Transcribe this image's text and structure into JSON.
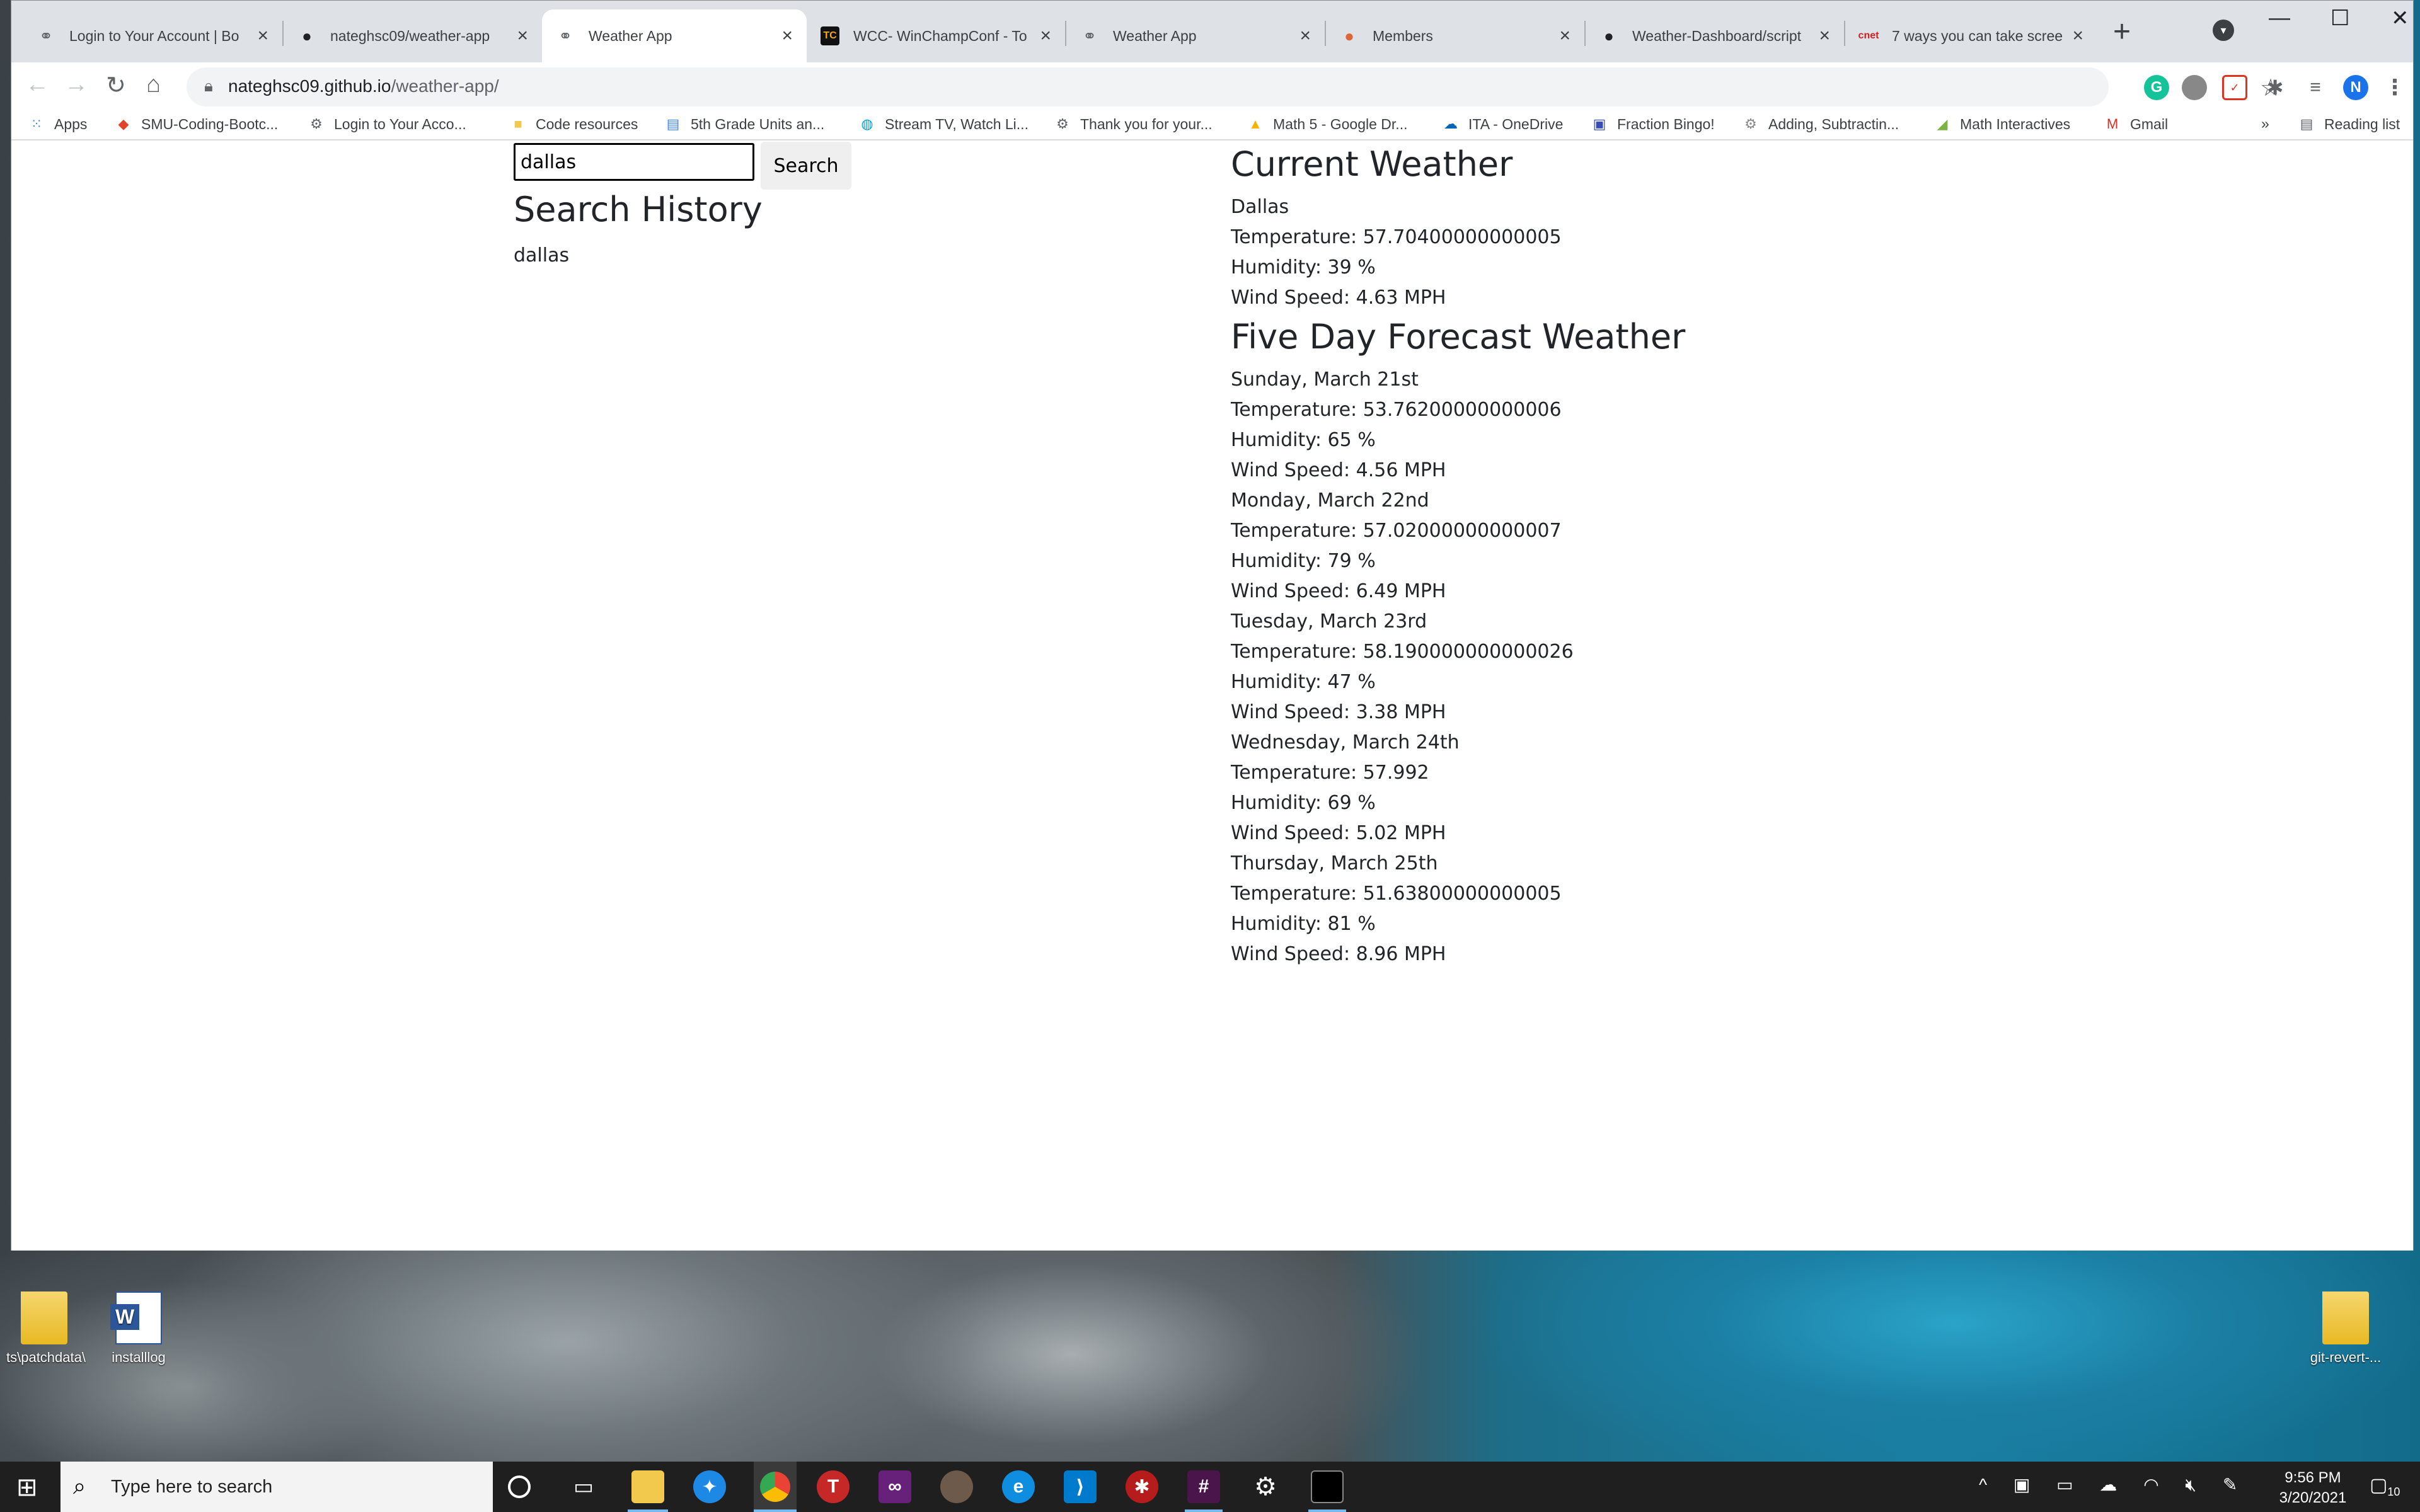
{
  "tabs": [
    {
      "title": "Login to Your Account | Bo",
      "icon": "globe-icon"
    },
    {
      "title": "nateghsc09/weather-app",
      "icon": "github-icon"
    },
    {
      "title": "Weather App",
      "icon": "globe-icon",
      "active": true
    },
    {
      "title": "WCC- WinChampConf - To",
      "icon": "tc-icon"
    },
    {
      "title": "Weather App",
      "icon": "globe-icon"
    },
    {
      "title": "Members",
      "icon": "members-icon"
    },
    {
      "title": "Weather-Dashboard/script",
      "icon": "github-icon"
    },
    {
      "title": "7 ways you can take scree",
      "icon": "cnet-icon"
    }
  ],
  "address": {
    "host": "nateghsc09.github.io",
    "path": "/weather-app/"
  },
  "profile_initial": "N",
  "bookmarks": [
    "Apps",
    "SMU-Coding-Bootc...",
    "Login to Your Acco...",
    "Code resources",
    "5th Grade Units an...",
    "Stream TV, Watch Li...",
    "Thank you for your...",
    "Math 5 - Google Dr...",
    "ITA - OneDrive",
    "Fraction Bingo!",
    "Adding, Subtractin...",
    "Math Interactives",
    "Gmail"
  ],
  "bookmarks_more": "»",
  "reading_list": "Reading list",
  "app": {
    "search_value": "dallas",
    "search_button": "Search",
    "history_title": "Search History",
    "history": [
      "dallas"
    ],
    "current_title": "Current Weather",
    "current": {
      "city": "Dallas",
      "temperature": "Temperature: 57.70400000000005",
      "humidity": "Humidity: 39 %",
      "wind": "Wind Speed: 4.63 MPH"
    },
    "forecast_title": "Five Day Forecast Weather",
    "forecast": [
      {
        "date": "Sunday, March 21st",
        "temperature": "Temperature: 53.76200000000006",
        "humidity": "Humidity: 65 %",
        "wind": "Wind Speed: 4.56 MPH"
      },
      {
        "date": "Monday, March 22nd",
        "temperature": "Temperature: 57.02000000000007",
        "humidity": "Humidity: 79 %",
        "wind": "Wind Speed: 6.49 MPH"
      },
      {
        "date": "Tuesday, March 23rd",
        "temperature": "Temperature: 58.190000000000026",
        "humidity": "Humidity: 47 %",
        "wind": "Wind Speed: 3.38 MPH"
      },
      {
        "date": "Wednesday, March 24th",
        "temperature": "Temperature: 57.992",
        "humidity": "Humidity: 69 %",
        "wind": "Wind Speed: 5.02 MPH"
      },
      {
        "date": "Thursday, March 25th",
        "temperature": "Temperature: 51.63800000000005",
        "humidity": "Humidity: 81 %",
        "wind": "Wind Speed: 8.96 MPH"
      }
    ]
  },
  "desktop_icons": [
    "ts\\patchdata\\",
    "installlog",
    "git-revert-..."
  ],
  "taskbar": {
    "search_placeholder": "Type here to search",
    "time": "9:56 PM",
    "date": "3/20/2021",
    "notifications": "10"
  }
}
